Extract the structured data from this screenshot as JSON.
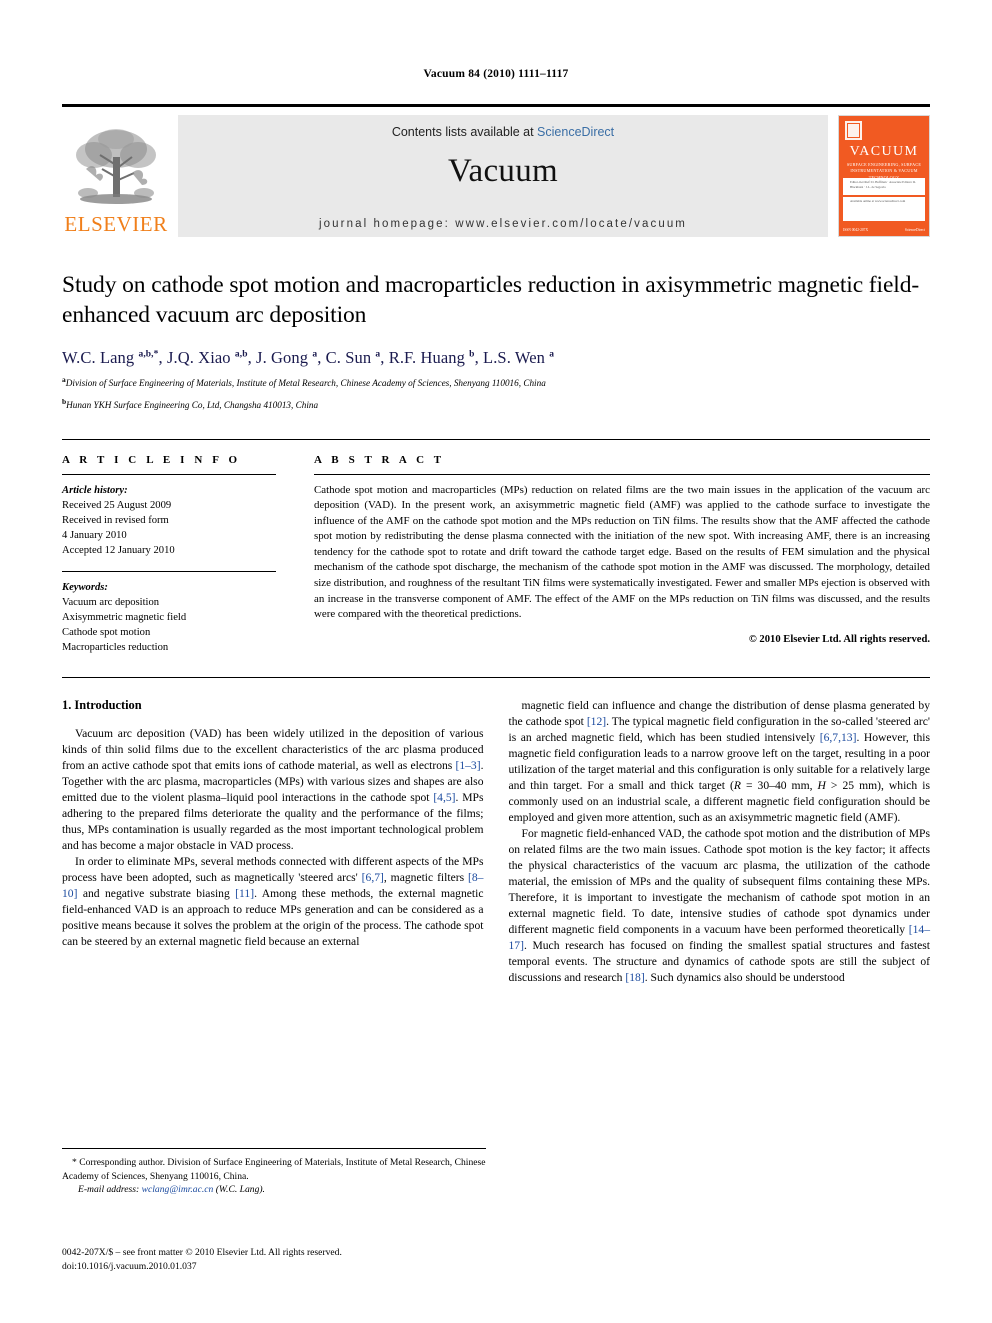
{
  "running_head": "Vacuum 84 (2010) 1111–1117",
  "masthead": {
    "contents_prefix": "Contents lists available at ",
    "sciencedirect": "ScienceDirect",
    "journal_name": "Vacuum",
    "homepage": "journal homepage: www.elsevier.com/locate/vacuum",
    "publisher_logo_text": "ELSEVIER",
    "publisher_logo_color": "#F07F1A",
    "cover": {
      "title": "VACUUM",
      "subtitle": "SURFACE ENGINEERING, SURFACE INSTRUMENTATION & VACUUM TECHNOLOGY",
      "editors_line": "Editor-in-Chief:  D. Hoffman  ·  Associate Editors:  R. Blackburn  ·  J.L. de Segovia",
      "body_line": "Available online at www.sciencedirect.com",
      "footer_left": "ISSN 0042-207X",
      "footer_right": "ScienceDirect",
      "background_color": "#F15A22"
    }
  },
  "article": {
    "title": "Study on cathode spot motion and macroparticles reduction in axisymmetric magnetic field-enhanced vacuum arc deposition",
    "authors_html": "W.C. Lang <sup>a,b,*</sup>, J.Q. Xiao <sup>a,b</sup>, J. Gong <sup>a</sup>, C. Sun <sup>a</sup>, R.F. Huang <sup>b</sup>, L.S. Wen <sup>a</sup>",
    "authors_color": "#1a1a4e",
    "affiliations": [
      "Division of Surface Engineering of Materials, Institute of Metal Research, Chinese Academy of Sciences, Shenyang 110016, China",
      "Hunan YKH Surface Engineering Co, Ltd, Changsha 410013, China"
    ],
    "affiliation_marks": [
      "a",
      "b"
    ]
  },
  "article_info": {
    "heading": "A R T I C L E   I N F O",
    "history_label": "Article history:",
    "history": [
      "Received 25 August 2009",
      "Received in revised form",
      "4 January 2010",
      "Accepted 12 January 2010"
    ],
    "keywords_label": "Keywords:",
    "keywords": [
      "Vacuum arc deposition",
      "Axisymmetric magnetic field",
      "Cathode spot motion",
      "Macroparticles reduction"
    ]
  },
  "abstract": {
    "heading": "A B S T R A C T",
    "text": "Cathode spot motion and macroparticles (MPs) reduction on related films are the two main issues in the application of the vacuum arc deposition (VAD). In the present work, an axisymmetric magnetic field (AMF) was applied to the cathode surface to investigate the influence of the AMF on the cathode spot motion and the MPs reduction on TiN films. The results show that the AMF affected the cathode spot motion by redistributing the dense plasma connected with the initiation of the new spot. With increasing AMF, there is an increasing tendency for the cathode spot to rotate and drift toward the cathode target edge. Based on the results of FEM simulation and the physical mechanism of the cathode spot discharge, the mechanism of the cathode spot motion in the AMF was discussed. The morphology, detailed size distribution, and roughness of the resultant TiN films were systematically investigated. Fewer and smaller MPs ejection is observed with an increase in the transverse component of AMF. The effect of the AMF on the MPs reduction on TiN films was discussed, and the results were compared with the theoretical predictions.",
    "copyright": "© 2010 Elsevier Ltd. All rights reserved."
  },
  "body": {
    "section_number_title": "1. Introduction",
    "left_paragraphs": [
      "Vacuum arc deposition (VAD) has been widely utilized in the deposition of various kinds of thin solid films due to the excellent characteristics of the arc plasma produced from an active cathode spot that emits ions of cathode material, as well as electrons [1–3]. Together with the arc plasma, macroparticles (MPs) with various sizes and shapes are also emitted due to the violent plasma–liquid pool interactions in the cathode spot [4,5]. MPs adhering to the prepared films deteriorate the quality and the performance of the films; thus, MPs contamination is usually regarded as the most important technological problem and has become a major obstacle in VAD process.",
      "In order to eliminate MPs, several methods connected with different aspects of the MPs process have been adopted, such as magnetically 'steered arcs' [6,7], magnetic filters [8–10] and negative substrate biasing [11]. Among these methods, the external magnetic field-enhanced VAD is an approach to reduce MPs generation and can be considered as a positive means because it solves the problem at the origin of the process. The cathode spot can be steered by an external magnetic field because an external"
    ],
    "right_paragraphs": [
      "magnetic field can influence and change the distribution of dense plasma generated by the cathode spot [12]. The typical magnetic field configuration in the so-called 'steered arc' is an arched magnetic field, which has been studied intensively [6,7,13]. However, this magnetic field configuration leads to a narrow groove left on the target, resulting in a poor utilization of the target material and this configuration is only suitable for a relatively large and thin target. For a small and thick target (R = 30–40 mm, H > 25 mm), which is commonly used on an industrial scale, a different magnetic field configuration should be employed and given more attention, such as an axisymmetric magnetic field (AMF).",
      "For magnetic field-enhanced VAD, the cathode spot motion and the distribution of MPs on related films are the two main issues. Cathode spot motion is the key factor; it affects the physical characteristics of the vacuum arc plasma, the utilization of the cathode material, the emission of MPs and the quality of subsequent films containing these MPs. Therefore, it is important to investigate the mechanism of cathode spot motion in an external magnetic field. To date, intensive studies of cathode spot dynamics under different magnetic field components in a vacuum have been performed theoretically [14–17]. Much research has focused on finding the smallest spatial structures and fastest temporal events. The structure and dynamics of cathode spots are still the subject of discussions and research [18]. Such dynamics also should be understood"
    ],
    "citation_color": "#1b4a9e"
  },
  "footnote": {
    "corresponding": "* Corresponding author. Division of Surface Engineering of Materials, Institute of Metal Research, Chinese Academy of Sciences, Shenyang 110016, China.",
    "email_label": "E-mail address:",
    "email": "wclang@imr.ac.cn",
    "email_owner": "(W.C. Lang)."
  },
  "page_footer": {
    "issn_line": "0042-207X/$ – see front matter © 2010 Elsevier Ltd. All rights reserved.",
    "doi_line": "doi:10.1016/j.vacuum.2010.01.037"
  }
}
